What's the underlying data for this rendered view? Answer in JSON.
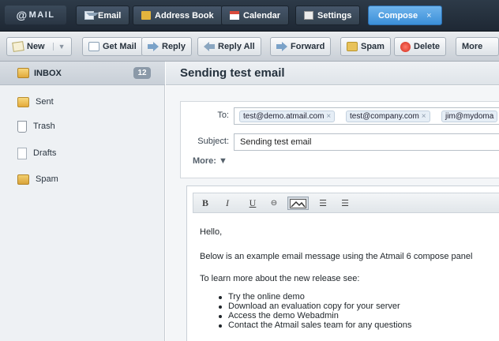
{
  "logo": {
    "at": "@",
    "text": "MAIL"
  },
  "nav": {
    "tabs": [
      {
        "label": "Email",
        "icon": "email-icon"
      },
      {
        "label": "Address Book",
        "icon": "address-book-icon"
      },
      {
        "label": "Calendar",
        "icon": "calendar-icon"
      },
      {
        "label": "Settings",
        "icon": "settings-icon"
      },
      {
        "label": "Compose",
        "icon": "",
        "active": true,
        "close": "×"
      }
    ]
  },
  "toolbar": {
    "new_label": "New",
    "get_mail_label": "Get Mail",
    "reply_label": "Reply",
    "reply_all_label": "Reply All",
    "forward_label": "Forward",
    "spam_label": "Spam",
    "delete_label": "Delete",
    "more_label": "More"
  },
  "sidebar": {
    "inbox": {
      "label": "INBOX",
      "count": "12"
    },
    "folders": [
      {
        "label": "Sent",
        "icon": "folder-icon"
      },
      {
        "label": "Trash",
        "icon": "trash-icon"
      },
      {
        "label": "Drafts",
        "icon": "document-icon"
      },
      {
        "label": "Spam",
        "icon": "folder-icon"
      }
    ]
  },
  "main": {
    "title": "Sending test email",
    "to_label": "To:",
    "subject_label": "Subject:",
    "more_label": "More: ▼",
    "recipients": [
      "test@demo.atmail.com",
      "test@company.com",
      "jim@mydoma"
    ],
    "subject_value": "Sending test email"
  },
  "editor": {
    "buttons": [
      "B",
      "I",
      "U",
      "⊖",
      "▭",
      "☰",
      "☰"
    ],
    "body": {
      "greeting": "Hello,",
      "line1": "Below is an example email message using the Atmail 6 compose panel",
      "line2": "To learn more about the new release see:",
      "bullets": [
        "Try the online demo",
        "Download an evaluation copy for your server",
        "Access the demo Webadmin",
        "Contact the Atmail sales team for any questions"
      ]
    }
  },
  "colors": {
    "topbar": "#24303c",
    "active_tab": "#4a9be0",
    "sidebar_bg": "#eef1f4",
    "badge": "#8b99a8"
  }
}
